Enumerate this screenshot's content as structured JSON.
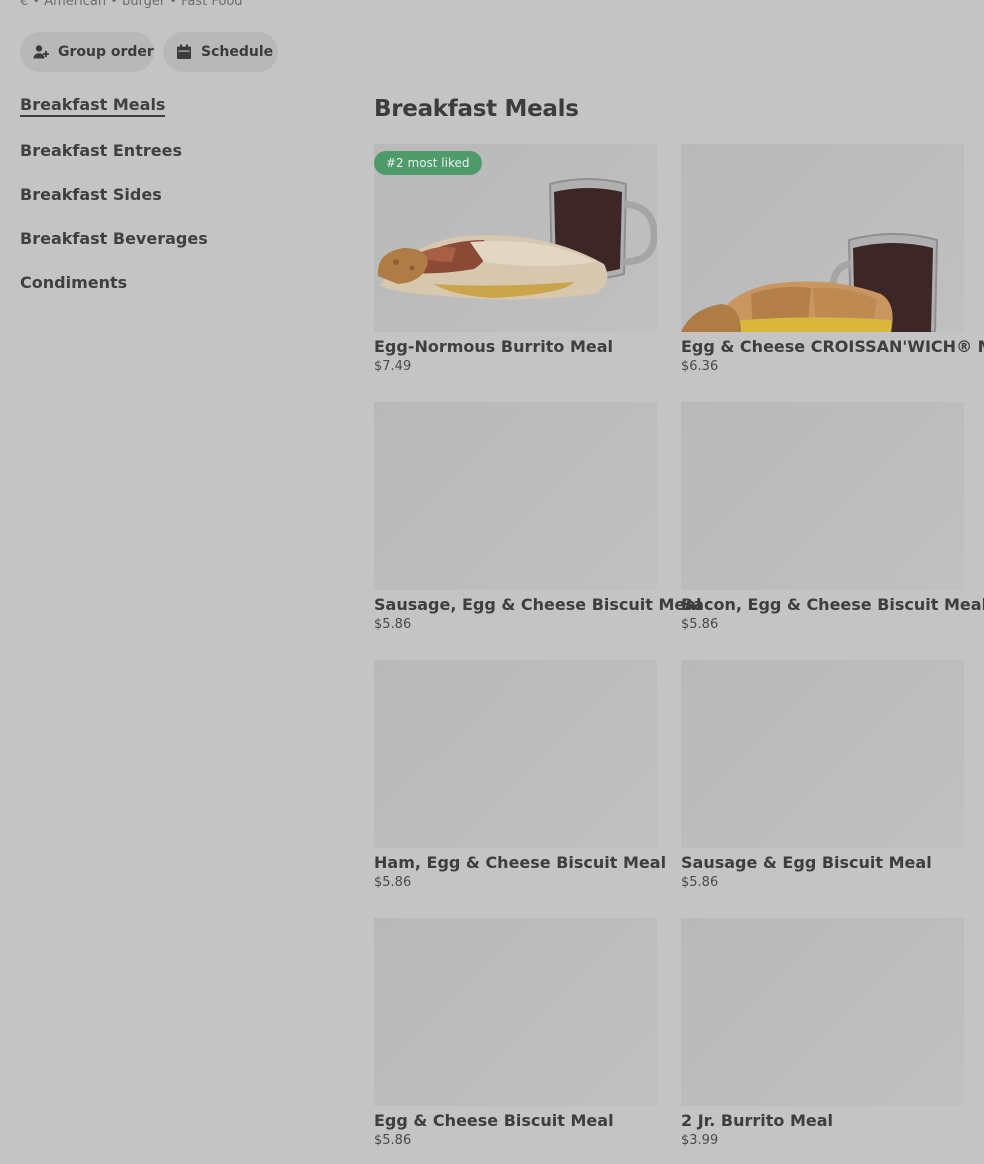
{
  "store": {
    "meta": "€ • American • burger • Fast Food"
  },
  "actions": {
    "group_order": "Group order",
    "schedule": "Schedule"
  },
  "nav": {
    "items": [
      {
        "label": "Breakfast Meals",
        "active": true
      },
      {
        "label": "Breakfast Entrees"
      },
      {
        "label": "Breakfast Sides"
      },
      {
        "label": "Breakfast Beverages"
      },
      {
        "label": "Condiments"
      }
    ]
  },
  "section": {
    "title": "Breakfast Meals"
  },
  "items": [
    {
      "name": "Egg-Normous Burrito Meal",
      "price": "$7.49",
      "badge": "#2 most liked",
      "image": "burrito-coffee"
    },
    {
      "name": "Egg & Cheese CROISSAN'WICH® Meal",
      "price": "$6.36",
      "image": "croissant-coffee"
    },
    {
      "name": "Sausage, Egg & Cheese Biscuit Meal",
      "price": "$5.86"
    },
    {
      "name": "Bacon, Egg & Cheese Biscuit Meal",
      "price": "$5.86"
    },
    {
      "name": "Ham, Egg & Cheese Biscuit Meal",
      "price": "$5.86"
    },
    {
      "name": "Sausage & Egg Biscuit Meal",
      "price": "$5.86"
    },
    {
      "name": "Egg & Cheese Biscuit Meal",
      "price": "$5.86"
    },
    {
      "name": "2 Jr. Burrito Meal",
      "price": "$3.99"
    }
  ]
}
